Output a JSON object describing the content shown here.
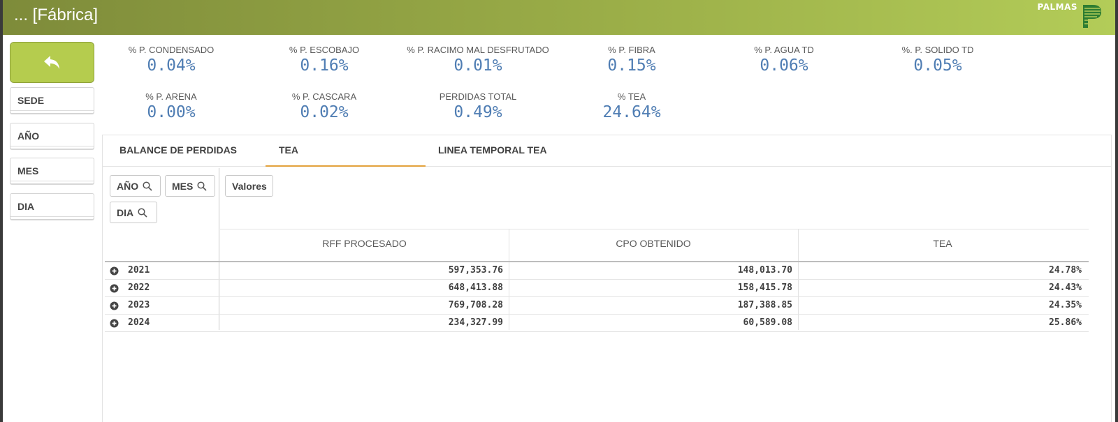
{
  "header": {
    "title": "... [Fábrica]",
    "logo_text": "PALMAS",
    "accent": "#9bae48"
  },
  "left_panel": {
    "back_icon": "undo-arrow-icon",
    "filters": [
      "SEDE",
      "AÑO",
      "MES",
      "DIA"
    ]
  },
  "kpis": [
    {
      "label": "% P. CONDENSADO",
      "value": "0.04%"
    },
    {
      "label": "% P. ESCOBAJO",
      "value": "0.16%"
    },
    {
      "label": "% P. RACIMO MAL DESFRUTADO",
      "value": "0.01%"
    },
    {
      "label": "% P. FIBRA",
      "value": "0.15%"
    },
    {
      "label": "% P. AGUA TD",
      "value": "0.06%"
    },
    {
      "label": "%. P. SOLIDO TD",
      "value": "0.05%"
    },
    {
      "label": "% P. ARENA",
      "value": "0.00%"
    },
    {
      "label": "% P. CASCARA",
      "value": "0.02%"
    },
    {
      "label": "PERDIDAS TOTAL",
      "value": "0.49%"
    },
    {
      "label": "% TEA",
      "value": "24.64%"
    }
  ],
  "tabs": [
    {
      "label": "BALANCE DE PERDIDAS",
      "active": false
    },
    {
      "label": "TEA",
      "active": true
    },
    {
      "label": "LINEA TEMPORAL TEA",
      "active": false
    }
  ],
  "pivot": {
    "dimension_chips": [
      "AÑO",
      "MES",
      "DIA"
    ],
    "measure_chip": "Valores",
    "columns": [
      "RFF PROCESADO",
      "CPO OBTENIDO",
      "TEA"
    ],
    "rows": [
      {
        "year": "2021",
        "values": [
          "597,353.76",
          "148,013.70",
          "24.78%"
        ]
      },
      {
        "year": "2022",
        "values": [
          "648,413.88",
          "158,415.78",
          "24.43%"
        ]
      },
      {
        "year": "2023",
        "values": [
          "769,708.28",
          "187,388.85",
          "24.35%"
        ]
      },
      {
        "year": "2024",
        "values": [
          "234,327.99",
          "60,589.08",
          "25.86%"
        ]
      }
    ]
  }
}
